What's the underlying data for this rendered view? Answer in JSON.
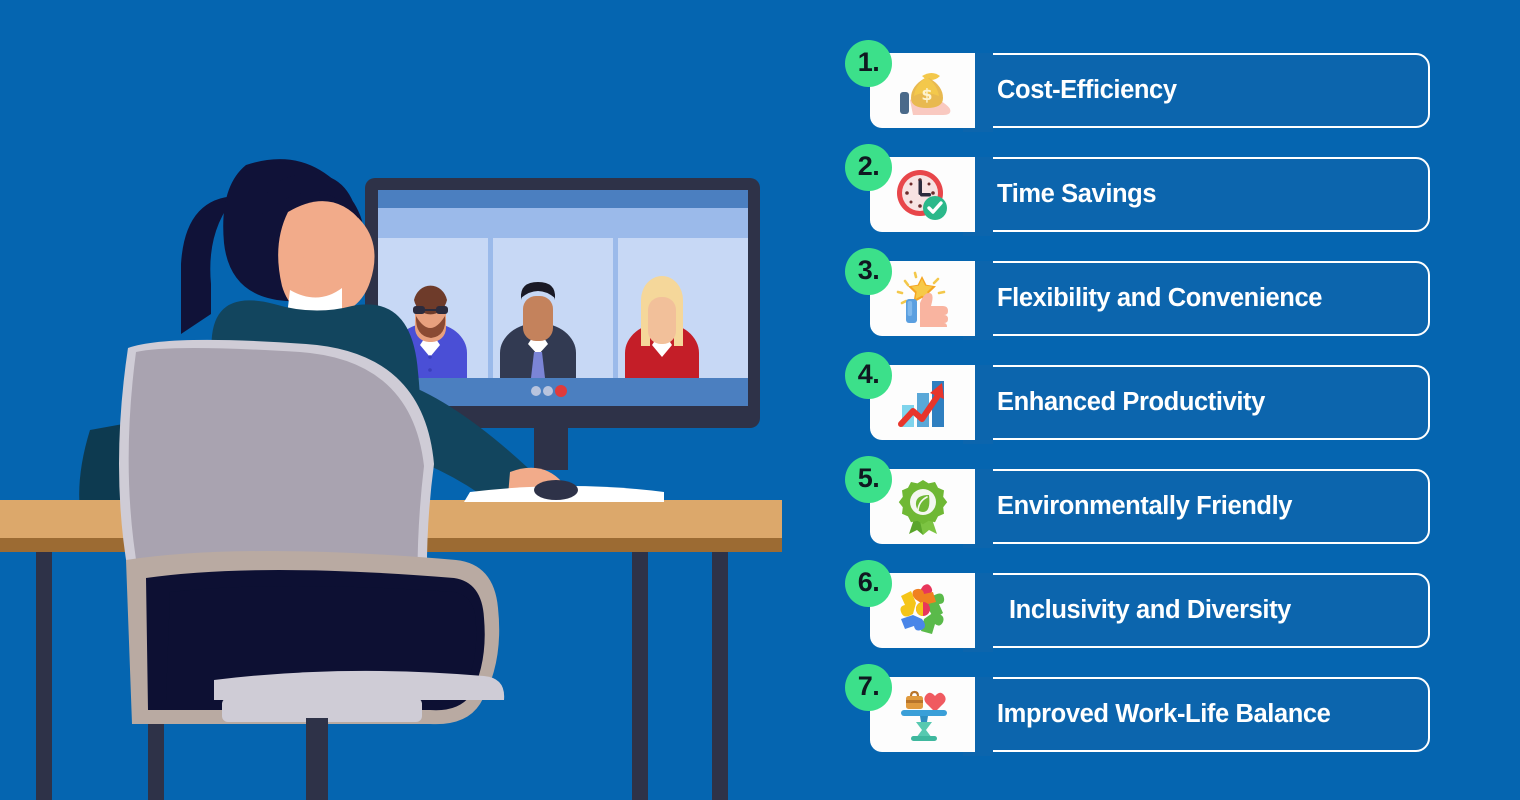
{
  "background_color": "#0565b0",
  "illustration": {
    "name": "man-on-video-conference-call",
    "description": "Flat illustration of a man seen from behind sitting in an office chair at a wooden desk, looking at a monitor showing a three-person video call",
    "colors": {
      "background": "#0565b0",
      "desk_top": "#dca86b",
      "desk_edge": "#9c6b33",
      "desk_leg": "#2e3248",
      "chair_back": "#a9a3b0",
      "chair_frame": "#b9aaa2",
      "chair_seat": "#0d1033",
      "shirt": "#12455e",
      "hair": "#101238",
      "skin": "#f2ab8a",
      "collar": "#ffffff",
      "monitor_frame": "#2e3248",
      "monitor_screen": "#c7d8f5",
      "monitor_bar": "#4b7fc0"
    },
    "monitor": {
      "name": "video-call-monitor",
      "participants": [
        {
          "name": "participant-1",
          "hair": "#6e3b2a",
          "shirt": "#4a4fd6",
          "glasses": true,
          "beard": true
        },
        {
          "name": "participant-2",
          "hair": "#1a1a26",
          "shirt": "#323a52",
          "tie": "#7b85d6",
          "glasses": false,
          "beard": false
        },
        {
          "name": "participant-3",
          "hair": "#f5d79a",
          "shirt": "#c41e28",
          "glasses": false,
          "beard": false
        }
      ],
      "status_dots": [
        "#b8c4de",
        "#b8c4de",
        "#e03b3b"
      ]
    },
    "desk_items": [
      {
        "name": "keyboard",
        "color": "#ffffff"
      },
      {
        "name": "mouse",
        "color": "#2e3248"
      }
    ]
  },
  "list": {
    "name": "benefits-list",
    "badge_color": "#3ce08a",
    "badge_text_color": "#101820",
    "card_color": "#0c65ad",
    "card_border_color": "#ffffff",
    "icon_panel_color": "#fdfdfd",
    "items": [
      {
        "number": "1.",
        "label": "Cost-Efficiency",
        "icon": "money-bag-on-hand-icon"
      },
      {
        "number": "2.",
        "label": "Time Savings",
        "icon": "clock-with-checkmark-icon"
      },
      {
        "number": "3.",
        "label": "Flexibility and Convenience",
        "icon": "thumbs-up-with-star-icon"
      },
      {
        "number": "4.",
        "label": "Enhanced Productivity",
        "icon": "bar-chart-with-up-arrow-icon"
      },
      {
        "number": "5.",
        "label": "Environmentally Friendly",
        "icon": "leaf-badge-icon"
      },
      {
        "number": "6.",
        "label": "Inclusivity and Diversity",
        "icon": "puzzle-pieces-icon"
      },
      {
        "number": "7.",
        "label": "Improved Work-Life Balance",
        "icon": "work-life-balance-scale-icon"
      }
    ]
  }
}
